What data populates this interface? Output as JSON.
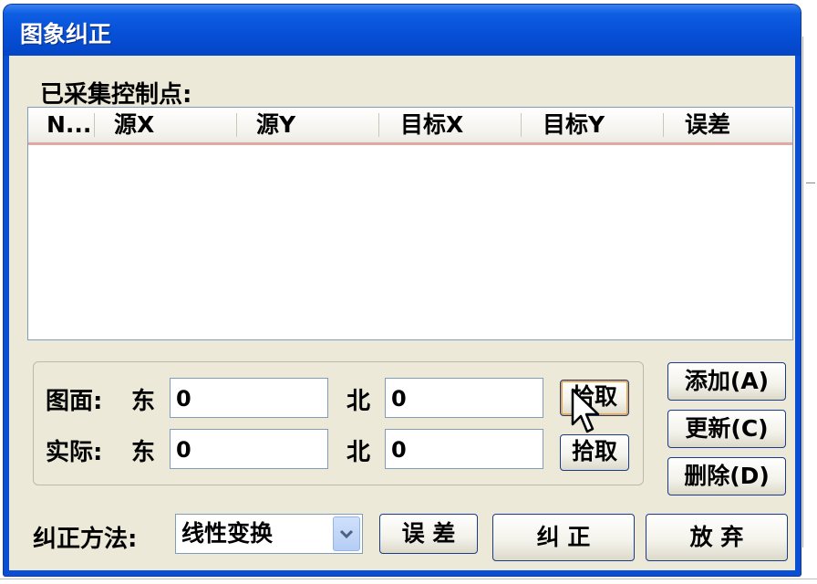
{
  "dialog": {
    "title": "图象纠正",
    "collected_label": "已采集控制点:"
  },
  "list": {
    "columns": [
      "N...",
      "源X",
      "源Y",
      "目标X",
      "目标Y",
      "误差"
    ]
  },
  "coords": {
    "map_label": "图面:",
    "actual_label": "实际:",
    "east_label": "东",
    "north_label": "北",
    "map_east": "0",
    "map_north": "0",
    "actual_east": "0",
    "actual_north": "0",
    "pick_label": "拾取"
  },
  "side_buttons": {
    "add": "添加(A)",
    "update": "更新(C)",
    "delete": "删除(D)"
  },
  "bottom": {
    "method_label": "纠正方法:",
    "method_value": "线性变换",
    "error_button": "误 差",
    "correct_button": "纠   正",
    "abandon_button": "放   弃"
  }
}
